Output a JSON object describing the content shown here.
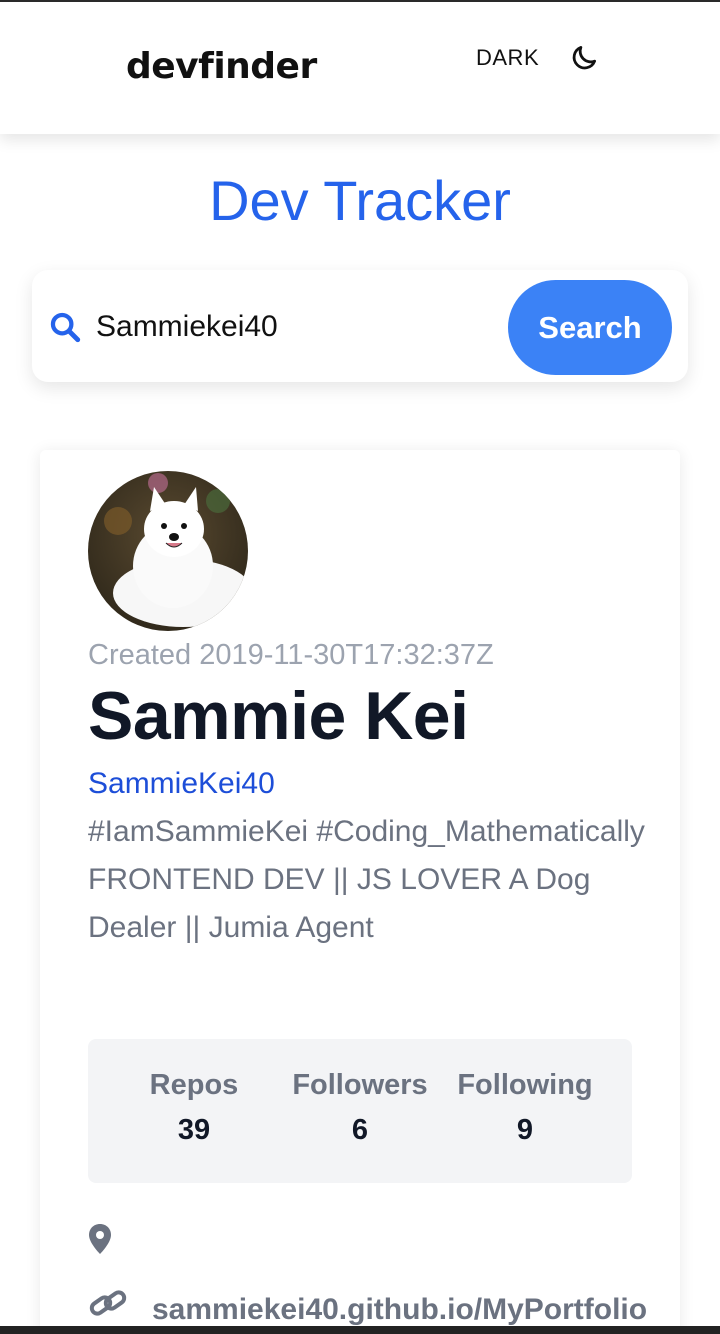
{
  "header": {
    "brand": "devfinder",
    "theme_label": "DARK",
    "theme_icon": "moon-icon"
  },
  "page_title": "Dev Tracker",
  "search": {
    "value": "Sammiekei40",
    "placeholder": "",
    "button_label": "Search",
    "icon": "search-icon"
  },
  "profile": {
    "created": "Created 2019-11-30T17:32:37Z",
    "name": "Sammie Kei",
    "username": "SammieKei40",
    "bio": "#IamSammieKei #Coding_Mathematically FRONTEND DEV || JS LOVER A Dog Dealer || Jumia Agent",
    "avatar_alt": "avatar",
    "stats": [
      {
        "label": "Repos",
        "value": "39"
      },
      {
        "label": "Followers",
        "value": "6"
      },
      {
        "label": "Following",
        "value": "9"
      }
    ],
    "location_icon": "map-pin-icon",
    "link_icon": "link-icon",
    "blog": "sammiekei40.github.io/MyPortfolio"
  },
  "colors": {
    "accent": "#2563eb",
    "button": "#3b82f6",
    "muted": "#6b7280",
    "stats_bg": "#f3f4f6"
  }
}
